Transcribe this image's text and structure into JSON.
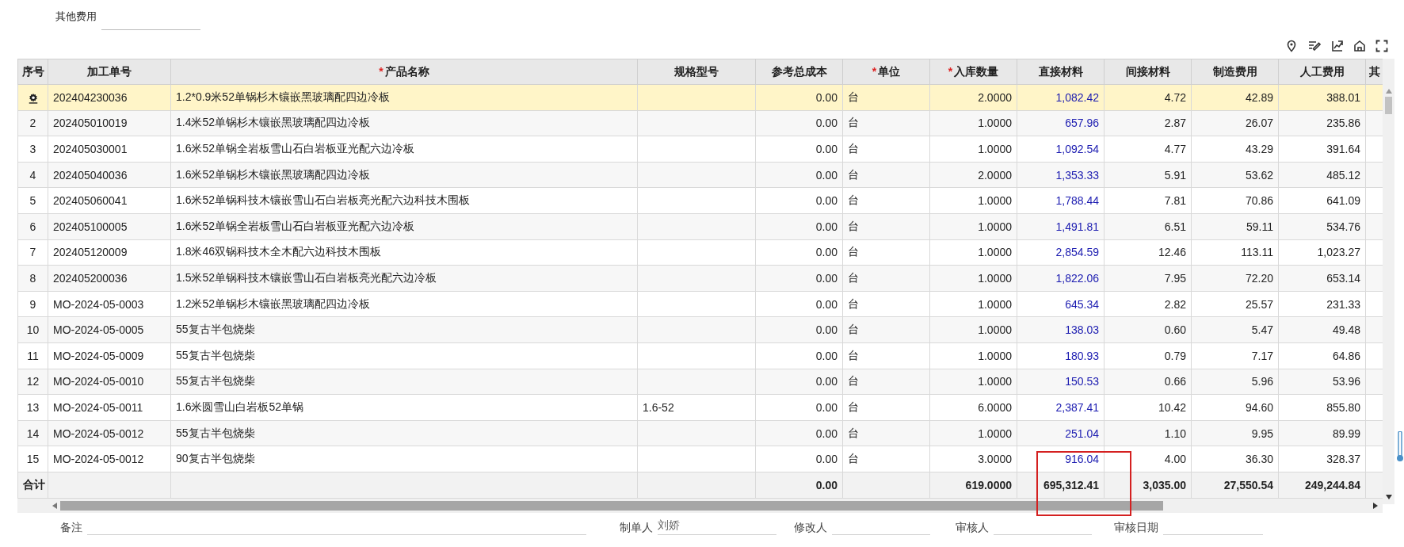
{
  "other_fee": {
    "label": "其他费用"
  },
  "table": {
    "columns": [
      {
        "label": "序号"
      },
      {
        "label": "加工单号"
      },
      {
        "label": "产品名称",
        "required_mark": "*"
      },
      {
        "label": "规格型号"
      },
      {
        "label": "参考总成本"
      },
      {
        "label": "单位",
        "required_mark": "*"
      },
      {
        "label": "入库数量",
        "required_mark": "*"
      },
      {
        "label": "直接材料"
      },
      {
        "label": "间接材料"
      },
      {
        "label": "制造费用"
      },
      {
        "label": "人工费用"
      },
      {
        "label": "其"
      }
    ],
    "rows": [
      {
        "selected": true,
        "order_no": "202404230036",
        "product": "1.2*0.9米52单锅杉木镶嵌黑玻璃配四边冷板",
        "ref_cost": "0.00",
        "unit": "台",
        "qty": "2.0000",
        "direct": "1,082.42",
        "indirect": "4.72",
        "manufacturing": "42.89",
        "labor": "388.01"
      },
      {
        "selected": false,
        "index": "2",
        "order_no": "202405010019",
        "product": "1.4米52单锅杉木镶嵌黑玻璃配四边冷板",
        "ref_cost": "0.00",
        "unit": "台",
        "qty": "1.0000",
        "direct": "657.96",
        "indirect": "2.87",
        "manufacturing": "26.07",
        "labor": "235.86"
      },
      {
        "selected": false,
        "index": "3",
        "order_no": "202405030001",
        "product": "1.6米52单锅全岩板雪山石白岩板亚光配六边冷板",
        "ref_cost": "0.00",
        "unit": "台",
        "qty": "1.0000",
        "direct": "1,092.54",
        "indirect": "4.77",
        "manufacturing": "43.29",
        "labor": "391.64"
      },
      {
        "selected": false,
        "index": "4",
        "order_no": "202405040036",
        "product": "1.6米52单锅杉木镶嵌黑玻璃配四边冷板",
        "ref_cost": "0.00",
        "unit": "台",
        "qty": "2.0000",
        "direct": "1,353.33",
        "indirect": "5.91",
        "manufacturing": "53.62",
        "labor": "485.12"
      },
      {
        "selected": false,
        "index": "5",
        "order_no": "202405060041",
        "product": "1.6米52单锅科技木镶嵌雪山石白岩板亮光配六边科技木围板",
        "ref_cost": "0.00",
        "unit": "台",
        "qty": "1.0000",
        "direct": "1,788.44",
        "indirect": "7.81",
        "manufacturing": "70.86",
        "labor": "641.09"
      },
      {
        "selected": false,
        "index": "6",
        "order_no": "202405100005",
        "product": "1.6米52单锅全岩板雪山石白岩板亚光配六边冷板",
        "ref_cost": "0.00",
        "unit": "台",
        "qty": "1.0000",
        "direct": "1,491.81",
        "indirect": "6.51",
        "manufacturing": "59.11",
        "labor": "534.76"
      },
      {
        "selected": false,
        "index": "7",
        "order_no": "202405120009",
        "product": "1.8米46双锅科技木全木配六边科技木围板",
        "ref_cost": "0.00",
        "unit": "台",
        "qty": "1.0000",
        "direct": "2,854.59",
        "indirect": "12.46",
        "manufacturing": "113.11",
        "labor": "1,023.27"
      },
      {
        "selected": false,
        "index": "8",
        "order_no": "202405200036",
        "product": "1.5米52单锅科技木镶嵌雪山石白岩板亮光配六边冷板",
        "ref_cost": "0.00",
        "unit": "台",
        "qty": "1.0000",
        "direct": "1,822.06",
        "indirect": "7.95",
        "manufacturing": "72.20",
        "labor": "653.14"
      },
      {
        "selected": false,
        "index": "9",
        "order_no": "MO-2024-05-0003",
        "product": "1.2米52单锅杉木镶嵌黑玻璃配四边冷板",
        "ref_cost": "0.00",
        "unit": "台",
        "qty": "1.0000",
        "direct": "645.34",
        "indirect": "2.82",
        "manufacturing": "25.57",
        "labor": "231.33"
      },
      {
        "selected": false,
        "index": "10",
        "order_no": "MO-2024-05-0005",
        "product": "55复古半包烧柴",
        "ref_cost": "0.00",
        "unit": "台",
        "qty": "1.0000",
        "direct": "138.03",
        "indirect": "0.60",
        "manufacturing": "5.47",
        "labor": "49.48"
      },
      {
        "selected": false,
        "index": "11",
        "order_no": "MO-2024-05-0009",
        "product": "55复古半包烧柴",
        "ref_cost": "0.00",
        "unit": "台",
        "qty": "1.0000",
        "direct": "180.93",
        "indirect": "0.79",
        "manufacturing": "7.17",
        "labor": "64.86"
      },
      {
        "selected": false,
        "index": "12",
        "order_no": "MO-2024-05-0010",
        "product": "55复古半包烧柴",
        "ref_cost": "0.00",
        "unit": "台",
        "qty": "1.0000",
        "direct": "150.53",
        "indirect": "0.66",
        "manufacturing": "5.96",
        "labor": "53.96"
      },
      {
        "selected": false,
        "index": "13",
        "order_no": "MO-2024-05-0011",
        "product": "1.6米圆雪山白岩板52单锅",
        "spec": "1.6-52",
        "ref_cost": "0.00",
        "unit": "台",
        "qty": "6.0000",
        "direct": "2,387.41",
        "indirect": "10.42",
        "manufacturing": "94.60",
        "labor": "855.80"
      },
      {
        "selected": false,
        "index": "14",
        "order_no": "MO-2024-05-0012",
        "product": "55复古半包烧柴",
        "ref_cost": "0.00",
        "unit": "台",
        "qty": "1.0000",
        "direct": "251.04",
        "indirect": "1.10",
        "manufacturing": "9.95",
        "labor": "89.99"
      },
      {
        "selected": false,
        "index": "15",
        "order_no": "MO-2024-05-0012",
        "product": "90复古半包烧柴",
        "ref_cost": "0.00",
        "unit": "台",
        "qty": "3.0000",
        "direct": "916.04",
        "indirect": "4.00",
        "manufacturing": "36.30",
        "labor": "328.37"
      }
    ],
    "totals": {
      "index": "合计",
      "ref_cost": "0.00",
      "qty": "619.0000",
      "direct": "695,312.41",
      "indirect": "3,035.00",
      "manufacturing": "27,550.54",
      "labor": "249,244.84"
    }
  },
  "footer": [
    {
      "label": "备注"
    },
    {
      "label": "制单人",
      "value": "刘娇"
    },
    {
      "label": "修改人"
    },
    {
      "label": "审核人"
    },
    {
      "label": "审核日期"
    }
  ]
}
